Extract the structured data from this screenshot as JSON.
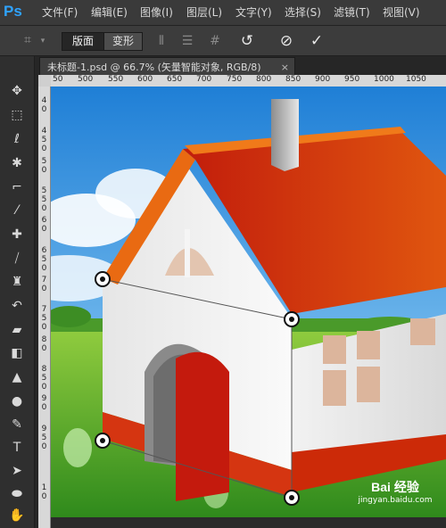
{
  "app": {
    "logo": "Ps"
  },
  "menu": [
    {
      "label": "文件(F)"
    },
    {
      "label": "编辑(E)"
    },
    {
      "label": "图像(I)"
    },
    {
      "label": "图层(L)"
    },
    {
      "label": "文字(Y)"
    },
    {
      "label": "选择(S)"
    },
    {
      "label": "滤镜(T)"
    },
    {
      "label": "视图(V)"
    }
  ],
  "options_bar": {
    "mode_on": "版面",
    "mode_off": "变形"
  },
  "document": {
    "tab_title": "未标题-1.psd @ 66.7% (矢量智能对象, RGB/8)",
    "close": "×"
  },
  "ruler": {
    "h_ticks": [
      "50",
      "500",
      "550",
      "600",
      "650",
      "700",
      "750",
      "800",
      "850",
      "900",
      "950",
      "1000",
      "1050"
    ],
    "v_ticks": [
      "4",
      "0",
      "4",
      "5",
      "0",
      "5",
      "0",
      "5",
      "5",
      "0",
      "6",
      "0",
      "6",
      "5",
      "0",
      "7",
      "0",
      "7",
      "5",
      "0",
      "8",
      "0",
      "8",
      "5",
      "0",
      "9",
      "0",
      "9",
      "5",
      "0",
      "1",
      "0"
    ]
  },
  "watermark": {
    "logo": "Bai 经验",
    "url": "jingyan.baidu.com"
  }
}
